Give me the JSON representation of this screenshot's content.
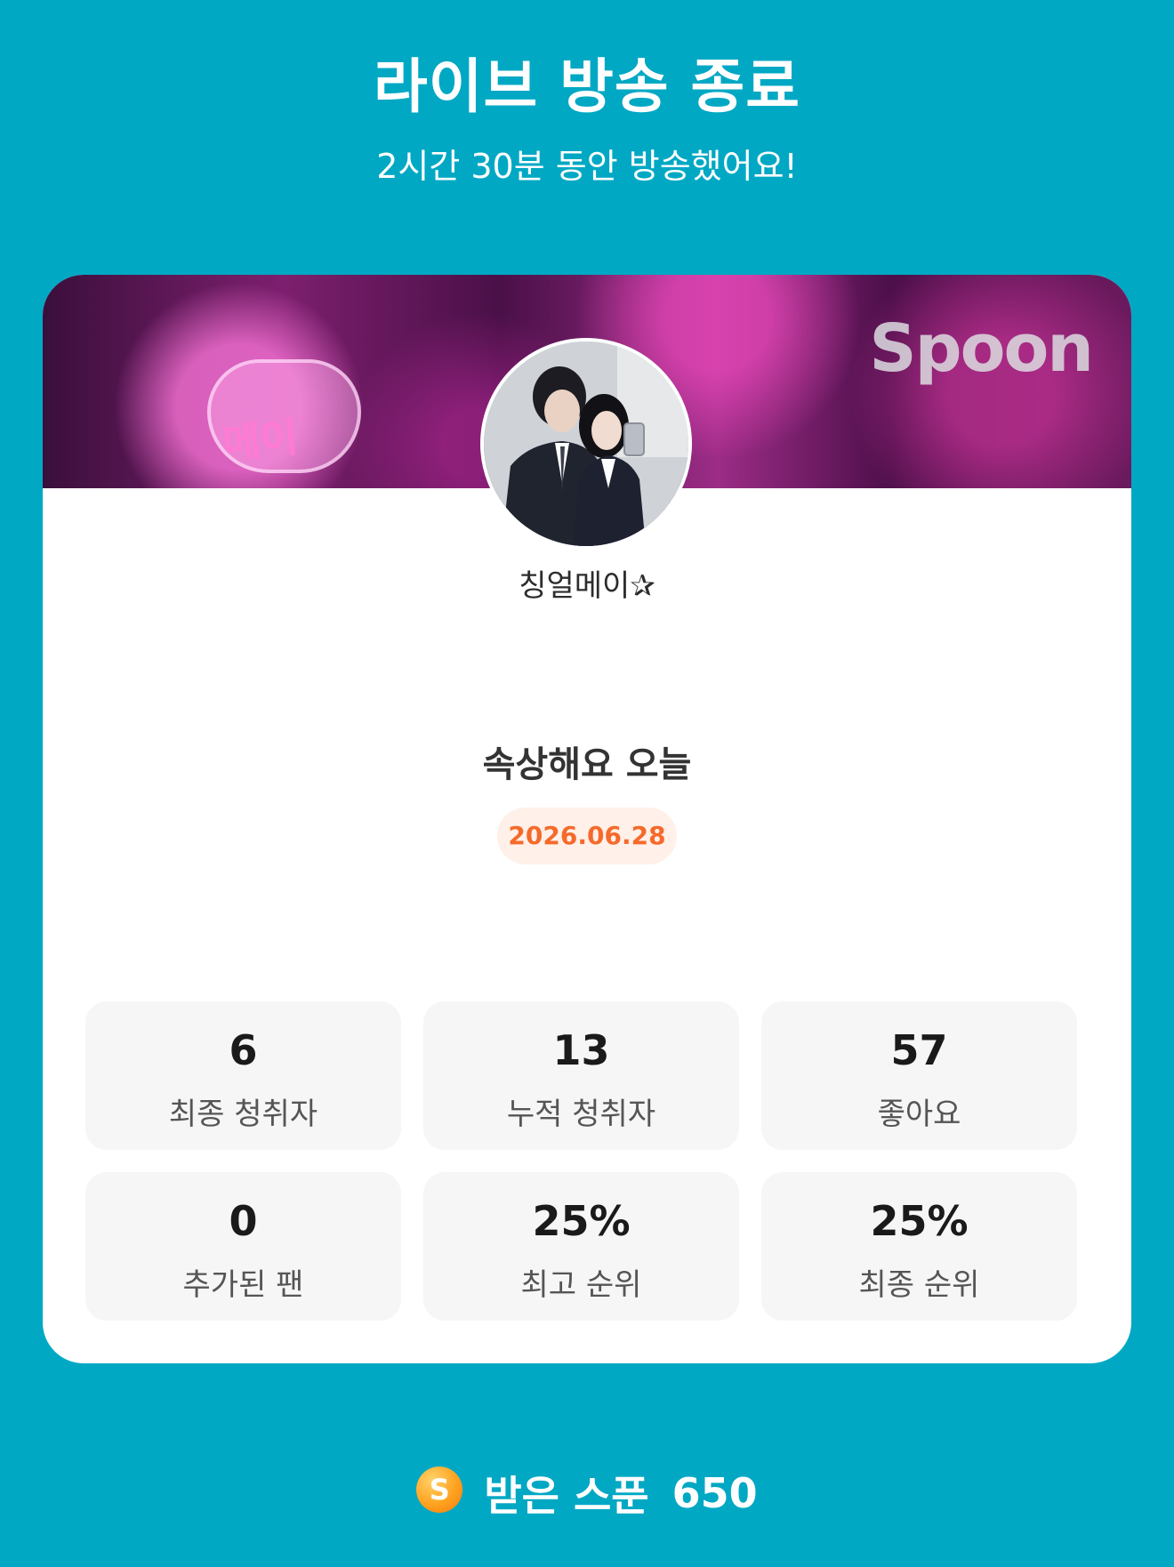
{
  "header": {
    "title": "라이브 방송 종료",
    "subtitle": "2시간 30분 동안 방송했어요!"
  },
  "card": {
    "banner": {
      "heart_text": "메이",
      "watermark": "Spoon"
    },
    "nickname": "칭얼메이✰",
    "broadcast_title": "속상해요 오늘",
    "date": "2026.06.28",
    "stats": [
      {
        "value": "6",
        "label": "최종 청취자"
      },
      {
        "value": "13",
        "label": "누적 청취자"
      },
      {
        "value": "57",
        "label": "좋아요"
      },
      {
        "value": "0",
        "label": "추가된 팬"
      },
      {
        "value": "25%",
        "label": "최고 순위"
      },
      {
        "value": "25%",
        "label": "최종 순위"
      }
    ]
  },
  "spoons": {
    "icon_letter": "S",
    "label": "받은 스푼",
    "count": "650"
  },
  "colors": {
    "background": "#00a8c4",
    "card": "#ffffff",
    "date_badge_bg": "#fff0e9",
    "date_badge_text": "#f56a2a",
    "stat_tile": "#f6f6f6",
    "spoon_icon": "#ffa21f"
  }
}
